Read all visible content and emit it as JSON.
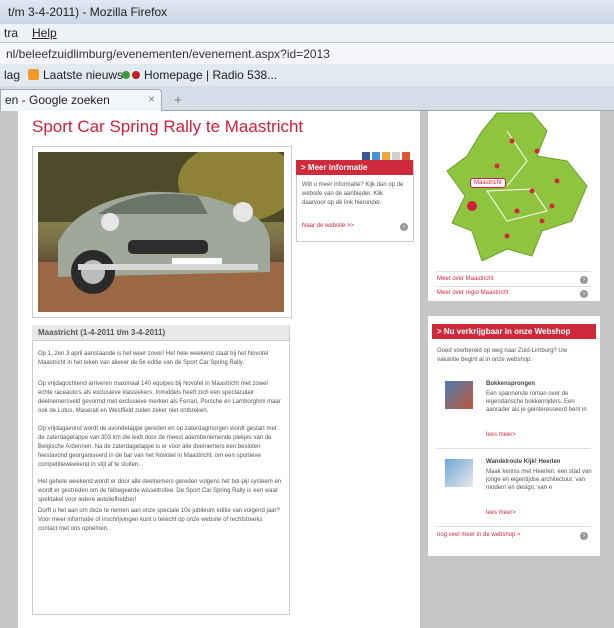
{
  "browser": {
    "window_title": "t/m 3-4-2011) - Mozilla Firefox",
    "menu": [
      "tra",
      "Help"
    ],
    "url": "nl/beleefzuidlimburg/evenementen/evenement.aspx?id=2013",
    "bookmarks": [
      "lag",
      "Laatste nieuws",
      "Homepage | Radio 538..."
    ],
    "tab_label": "en - Google zoeken",
    "tab_close": "×",
    "new_tab": "+"
  },
  "page": {
    "title": "Sport Car Spring Rally te Maastricht",
    "info": {
      "heading": "> Meer informatie",
      "text": "Wilt u meer informatie? Kijk dan op de website van de aanbieder. Klik daarvoor op de link hieronder.",
      "link": "Naar de website >>"
    },
    "article": {
      "heading": "Maastricht (1-4-2011 t/m 3-4-2011)",
      "paragraphs": [
        "Op 1, 2en 3 april aanstaande is het weer zover! Het hele weekend staat bij het Novotel Maastricht in het teken van alweer de 5e editie van de Sport Car Spring Rally.",
        "Op vrijdagochtend arriveren maximaal 140 equipes bij Novotel in Maastricht met zowel echte raceauto's als exclusieve klassiekers. Inmiddels heeft zich een spectaculair deelnemersveld gevormd met exclusieve merken als Ferrari, Porsche en Lamborghini maar ook de Lotus, Maserati en Westfield zullen zeker niet ontbreken.",
        "Op vrijdagavond wordt de avondetappe gereden en op zaterdagmorgen wordt gestart met de zaterdagetappe van 303 km die leidt door de meest adembenemende plekjes van de Belgische Ardennen. Na de zaterdagetappe is er voor alle deelnemers een besloten feestavond georganiseerd in de bar van het Novotel in Maastricht, om een sportieve competitieweekend in stijl af te sluiten.",
        "Het gehele weekend wordt er door alle deelnemers gereden volgens het bol-pijl systeem en wordt er gestreden om de felbegeerde wisseltrofee. De Sport Car Spring Rally is een waar spektakel voor iedere autoliefhebber!",
        "Durft u het aan om deze te nemen aan onze speciale 10e jubileum editie van volgend jaar? Voor meer informatie of inschrijvingen kunt u terecht op onze website of rechtstreeks contact met ons opnemen."
      ]
    },
    "map": {
      "label": "Maastricht",
      "links": [
        "Meer over Maastricht",
        "Meer over regio Maastricht"
      ]
    },
    "shop": {
      "heading": "> Nu verkrijgbaar in onze Webshop",
      "intro": "Goed voorbereid op weg naar Zuid-Limburg? Uw vakantie begint al in onze webshop.",
      "items": [
        {
          "title": "Bokkensprongen",
          "desc": "Een spannende roman over de legendarische bokkenrijders. Een aanrader als je geinteresseerd bent in",
          "link": "lees meer>"
        },
        {
          "title": "Wandelroute Kijk! Heerlen",
          "desc": "Maak kennis met Heerlen: een stad van jonge en eigentijdse architectuur, van modern en design, van e",
          "link": "lees meer>"
        }
      ],
      "more_link": "nog veel meer in de webshop >"
    }
  },
  "colors": {
    "brand_red": "#cf2a3c",
    "map_green": "#8fc43e"
  }
}
